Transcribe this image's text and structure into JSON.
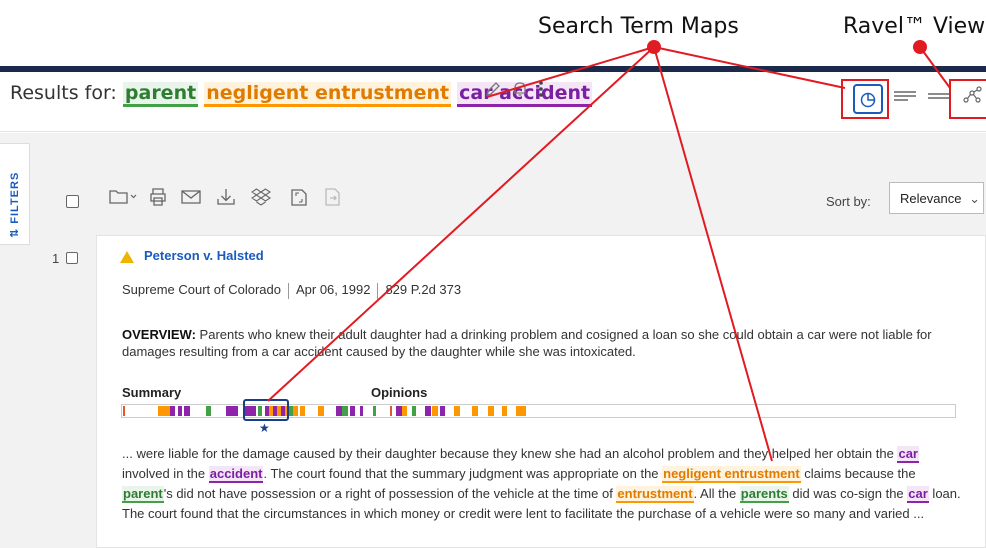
{
  "callouts": {
    "search_term_maps": "Search Term Maps",
    "ravel_view": "Ravel™ View"
  },
  "header": {
    "results_prefix": "Results for:",
    "terms": [
      {
        "text": "parent",
        "color": "#43a047"
      },
      {
        "text": "negligent entrustment",
        "color": "#ff9800"
      },
      {
        "text": "car accident",
        "color": "#8e24aa"
      }
    ],
    "edit_icon": "pencil-icon",
    "alert_icon": "bell-icon",
    "more_icon": "vertical-dots-icon"
  },
  "views": {
    "search_term_maps_icon": "pie-chart-icon",
    "full_view_icon": "lines-icon",
    "list_view_icon": "two-lines-icon",
    "ravel_icon": "network-graph-icon",
    "active_color": "#1a5bbf"
  },
  "sidebar": {
    "filters_label": "FILTERS"
  },
  "toolbar": {
    "icons": [
      "select-all-checkbox",
      "folder-icon",
      "print-icon",
      "email-icon",
      "download-icon",
      "dropbox-icon",
      "copy-icon",
      "export-icon"
    ],
    "sort_label": "Sort by:",
    "sort_value": "Relevance",
    "sort_chevron": "⌄"
  },
  "results": [
    {
      "number": "1",
      "flag_color": "#f0b400",
      "title": "Peterson v. Halsted",
      "court": "Supreme Court of Colorado",
      "date": "Apr 06, 1992",
      "citation": "829 P.2d 373",
      "overview_label": "OVERVIEW:",
      "overview_text": " Parents who knew their adult daughter had a drinking problem and cosigned a loan so she could obtain a car were not liable for damages resulting from a car accident caused by the daughter while she was intoxicated.",
      "map_headings": {
        "summary": "Summary",
        "opinions": "Opinions"
      },
      "term_map_segments": [
        {
          "offset": 0,
          "width": 2,
          "color": "#e4572e"
        },
        {
          "offset": 18,
          "width": 12,
          "color": "#ff9800"
        },
        {
          "offset": 30,
          "width": 5,
          "color": "#8e24aa"
        },
        {
          "offset": 38,
          "width": 4,
          "color": "#8e24aa"
        },
        {
          "offset": 44,
          "width": 6,
          "color": "#8e24aa"
        },
        {
          "offset": 66,
          "width": 5,
          "color": "#43a047"
        },
        {
          "offset": 86,
          "width": 6,
          "color": "#8e24aa"
        },
        {
          "offset": 92,
          "width": 6,
          "color": "#8e24aa"
        },
        {
          "offset": 104,
          "width": 12,
          "color": "#8e24aa"
        },
        {
          "offset": 118,
          "width": 4,
          "color": "#43a047"
        },
        {
          "offset": 125,
          "width": 4,
          "color": "#8e24aa"
        },
        {
          "offset": 129,
          "width": 4,
          "color": "#ff9800"
        },
        {
          "offset": 133,
          "width": 4,
          "color": "#8e24aa"
        },
        {
          "offset": 137,
          "width": 4,
          "color": "#ff9800"
        },
        {
          "offset": 141,
          "width": 4,
          "color": "#8e24aa"
        },
        {
          "offset": 145,
          "width": 4,
          "color": "#ff9800"
        },
        {
          "offset": 149,
          "width": 4,
          "color": "#43a047"
        },
        {
          "offset": 153,
          "width": 5,
          "color": "#ff9800"
        },
        {
          "offset": 160,
          "width": 5,
          "color": "#ff9800"
        },
        {
          "offset": 178,
          "width": 6,
          "color": "#ff9800"
        },
        {
          "offset": 196,
          "width": 6,
          "color": "#8e24aa"
        },
        {
          "offset": 202,
          "width": 6,
          "color": "#43a047"
        },
        {
          "offset": 210,
          "width": 5,
          "color": "#8e24aa"
        },
        {
          "offset": 220,
          "width": 3,
          "color": "#8e24aa"
        },
        {
          "offset": 233,
          "width": 3,
          "color": "#43a047"
        },
        {
          "offset": 250,
          "width": 2,
          "color": "#e4572e"
        },
        {
          "offset": 256,
          "width": 6,
          "color": "#8e24aa"
        },
        {
          "offset": 262,
          "width": 5,
          "color": "#ff9800"
        },
        {
          "offset": 272,
          "width": 4,
          "color": "#43a047"
        },
        {
          "offset": 285,
          "width": 6,
          "color": "#8e24aa"
        },
        {
          "offset": 292,
          "width": 6,
          "color": "#ff9800"
        },
        {
          "offset": 300,
          "width": 5,
          "color": "#8e24aa"
        },
        {
          "offset": 314,
          "width": 6,
          "color": "#ff9800"
        },
        {
          "offset": 332,
          "width": 6,
          "color": "#ff9800"
        },
        {
          "offset": 348,
          "width": 6,
          "color": "#ff9800"
        },
        {
          "offset": 362,
          "width": 5,
          "color": "#ff9800"
        },
        {
          "offset": 376,
          "width": 4,
          "color": "#ff9800"
        },
        {
          "offset": 380,
          "width": 6,
          "color": "#ff9800"
        }
      ],
      "snippet": [
        {
          "t": "... were liable for the damage caused by their daughter because they knew she had an alcohol problem and they helped her obtain the "
        },
        {
          "t": "car",
          "hl": "purple"
        },
        {
          "t": " involved in the "
        },
        {
          "t": "accident",
          "hl": "purple"
        },
        {
          "t": ". The court found that the summary judgment was appropriate on the "
        },
        {
          "t": "negligent entrustment",
          "hl": "orange"
        },
        {
          "t": " claims because the "
        },
        {
          "t": "parent",
          "hl": "green"
        },
        {
          "t": "'s did not have possession or a right of possession of the vehicle at the time of "
        },
        {
          "t": "entrustment",
          "hl": "orange"
        },
        {
          "t": ". All the "
        },
        {
          "t": "parents",
          "hl": "green"
        },
        {
          "t": " did was co-sign the "
        },
        {
          "t": "car",
          "hl": "purple"
        },
        {
          "t": " loan. The court found that the circumstances in which money or credit were lent to facilitate the purchase of a vehicle were so many and varied ..."
        }
      ]
    }
  ],
  "colors": {
    "annotation": "#e11b22",
    "nav_bar": "#1b2a4a",
    "link": "#1a5bbf"
  }
}
